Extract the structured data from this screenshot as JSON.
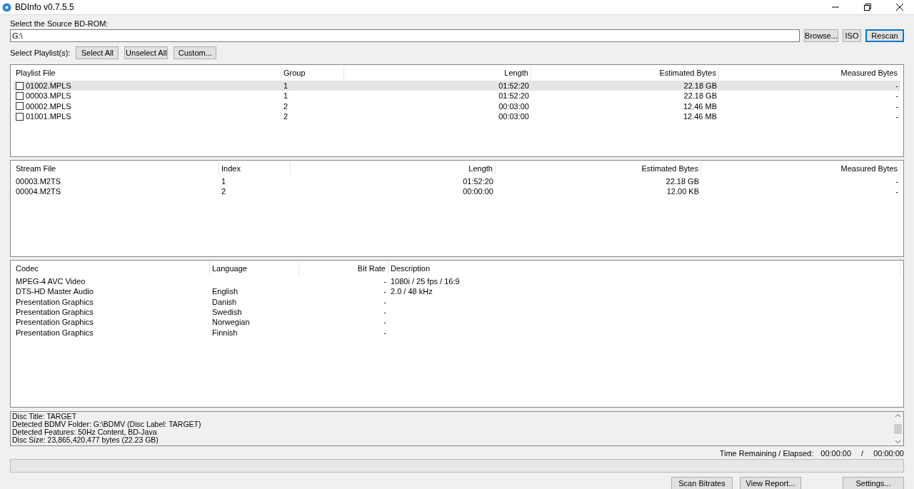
{
  "window": {
    "title": "BDInfo v0.7.5.5"
  },
  "source": {
    "label": "Select the Source BD-ROM:",
    "value": "G:\\",
    "buttons": [
      {
        "label": "Browse...",
        "focused": false
      },
      {
        "label": "ISO",
        "focused": false
      },
      {
        "label": "Rescan",
        "focused": true
      }
    ]
  },
  "playlist_select": {
    "label": "Select Playlist(s):",
    "buttons": [
      "Select All",
      "Unselect All",
      "Custom..."
    ]
  },
  "playlists": {
    "columns": [
      "Playlist File",
      "Group",
      "Length",
      "Estimated Bytes",
      "Measured Bytes"
    ],
    "rows": [
      {
        "cells": [
          "01002.MPLS",
          "1",
          "01:52:20",
          "22.18 GB",
          "-"
        ],
        "checked": false,
        "selected": true
      },
      {
        "cells": [
          "00003.MPLS",
          "1",
          "01:52:20",
          "22.18 GB",
          "-"
        ],
        "checked": false,
        "selected": false
      },
      {
        "cells": [
          "00002.MPLS",
          "2",
          "00:03:00",
          "12.46 MB",
          "-"
        ],
        "checked": false,
        "selected": false
      },
      {
        "cells": [
          "01001.MPLS",
          "2",
          "00:03:00",
          "12.46 MB",
          "-"
        ],
        "checked": false,
        "selected": false
      }
    ]
  },
  "streams": {
    "columns": [
      "Stream File",
      "Index",
      "Length",
      "Estimated Bytes",
      "Measured Bytes"
    ],
    "rows": [
      {
        "cells": [
          "00003.M2TS",
          "1",
          "01:52:20",
          "22.18 GB",
          "-"
        ]
      },
      {
        "cells": [
          "00004.M2TS",
          "2",
          "00:00:00",
          "12.00 KB",
          "-"
        ]
      }
    ]
  },
  "codecs": {
    "columns": [
      "Codec",
      "Language",
      "Bit Rate",
      "Description"
    ],
    "rows": [
      {
        "cells": [
          "MPEG-4 AVC Video",
          "",
          "-",
          "1080i / 25 fps / 16:9"
        ]
      },
      {
        "cells": [
          "DTS-HD Master Audio",
          "English",
          "-",
          "2.0 / 48 kHz"
        ]
      },
      {
        "cells": [
          "Presentation Graphics",
          "Danish",
          "-",
          ""
        ]
      },
      {
        "cells": [
          "Presentation Graphics",
          "Swedish",
          "-",
          ""
        ]
      },
      {
        "cells": [
          "Presentation Graphics",
          "Norwegian",
          "-",
          ""
        ]
      },
      {
        "cells": [
          "Presentation Graphics",
          "Finnish",
          "-",
          ""
        ]
      }
    ]
  },
  "disc_info": [
    "Disc Title: TARGET",
    "Detected BDMV Folder: G:\\BDMV (Disc Label: TARGET)",
    "Detected Features: 50Hz Content, BD-Java",
    "Disc Size: 23,865,420,477 bytes (22.23 GB)"
  ],
  "time": {
    "label": "Time Remaining / Elapsed:",
    "remaining": "00:00:00",
    "separator": "/",
    "elapsed": "00:00:00"
  },
  "progress": {
    "level": 0
  },
  "buttons": [
    "Scan Bitrates",
    "View Report...",
    "Settings..."
  ]
}
